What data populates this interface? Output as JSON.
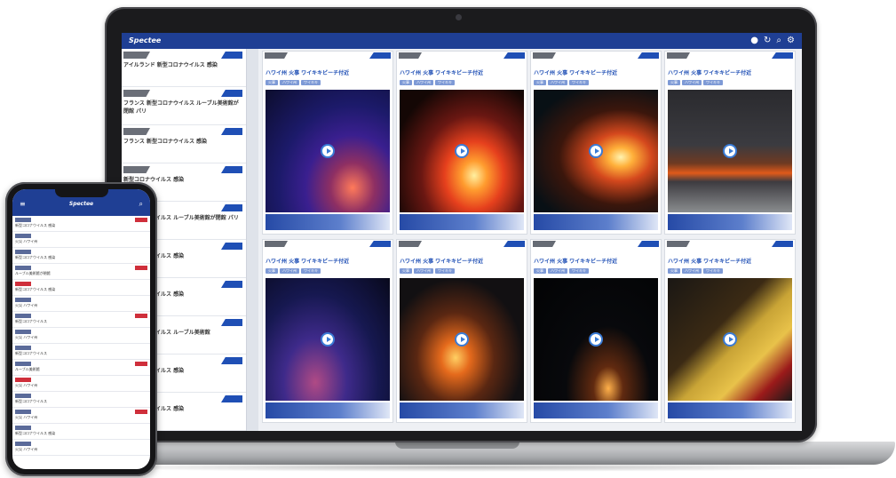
{
  "app": {
    "name": "Spectee"
  },
  "header_icons": [
    "notification-icon",
    "refresh-icon",
    "search-icon",
    "settings-icon"
  ],
  "sidebar": {
    "items": [
      {
        "title": "アイルランド 新型コロナウイルス 感染"
      },
      {
        "title": "フランス 新型コロナウイルス ルーブル美術館が閉館 パリ"
      },
      {
        "title": "フランス 新型コロナウイルス 感染"
      },
      {
        "title": "新型コロナウイルス 感染"
      },
      {
        "title": "新型コロナウイルス ルーブル美術館が閉館 パリ"
      },
      {
        "title": "新型コロナウイルス 感染"
      },
      {
        "title": "新型コロナウイルス 感染"
      },
      {
        "title": "新型コロナウイルス ルーブル美術館"
      },
      {
        "title": "新型コロナウイルス 感染"
      },
      {
        "title": "新型コロナウイルス 感染"
      }
    ]
  },
  "cards": [
    {
      "title": "ハワイ州 火事 ワイキキビーチ付近",
      "chips": [
        "火事",
        "ハワイ州",
        "ワイキキ"
      ],
      "image": "img-blue"
    },
    {
      "title": "ハワイ州 火事 ワイキキビーチ付近",
      "chips": [
        "火事",
        "ハワイ州",
        "ワイキキ"
      ],
      "image": "img-fire1"
    },
    {
      "title": "ハワイ州 火事 ワイキキビーチ付近",
      "chips": [
        "火事",
        "ハワイ州",
        "ワイキキ"
      ],
      "image": "img-fire2"
    },
    {
      "title": "ハワイ州 火事 ワイキキビーチ付近",
      "chips": [
        "火事",
        "ハワイ州",
        "ワイキキ"
      ],
      "image": "img-smoke"
    },
    {
      "title": "ハワイ州 火事 ワイキキビーチ付近",
      "chips": [
        "火事",
        "ハワイ州",
        "ワイキキ"
      ],
      "image": "img-night"
    },
    {
      "title": "ハワイ州 火事 ワイキキビーチ付近",
      "chips": [
        "火事",
        "ハワイ州",
        "ワイキキ"
      ],
      "image": "img-street"
    },
    {
      "title": "ハワイ州 火事 ワイキキビーチ付近",
      "chips": [
        "火事",
        "ハワイ州",
        "ワイキキ"
      ],
      "image": "img-dark"
    },
    {
      "title": "ハワイ州 火事 ワイキキビーチ付近",
      "chips": [
        "火事",
        "ハワイ州",
        "ワイキキ"
      ],
      "image": "img-truck"
    }
  ],
  "phone": {
    "logo": "Spectee",
    "items": [
      {
        "text": "新型コロナウイルス 感染",
        "red": false
      },
      {
        "text": "火災 ハワイ州",
        "red": false
      },
      {
        "text": "新型コロナウイルス 感染",
        "red": false
      },
      {
        "text": "ルーブル美術館が閉館",
        "red": false
      },
      {
        "text": "新型コロナウイルス 感染",
        "red": true
      },
      {
        "text": "火災 ハワイ州",
        "red": false
      },
      {
        "text": "新型コロナウイルス",
        "red": false
      },
      {
        "text": "火災 ハワイ州",
        "red": false
      },
      {
        "text": "新型コロナウイルス",
        "red": false
      },
      {
        "text": "ルーブル美術館",
        "red": false
      },
      {
        "text": "火災 ハワイ州",
        "red": true
      },
      {
        "text": "新型コロナウイルス",
        "red": false
      },
      {
        "text": "火災 ハワイ州",
        "red": false
      },
      {
        "text": "新型コロナウイルス 感染",
        "red": false
      },
      {
        "text": "火災 ハワイ州",
        "red": false
      }
    ]
  }
}
